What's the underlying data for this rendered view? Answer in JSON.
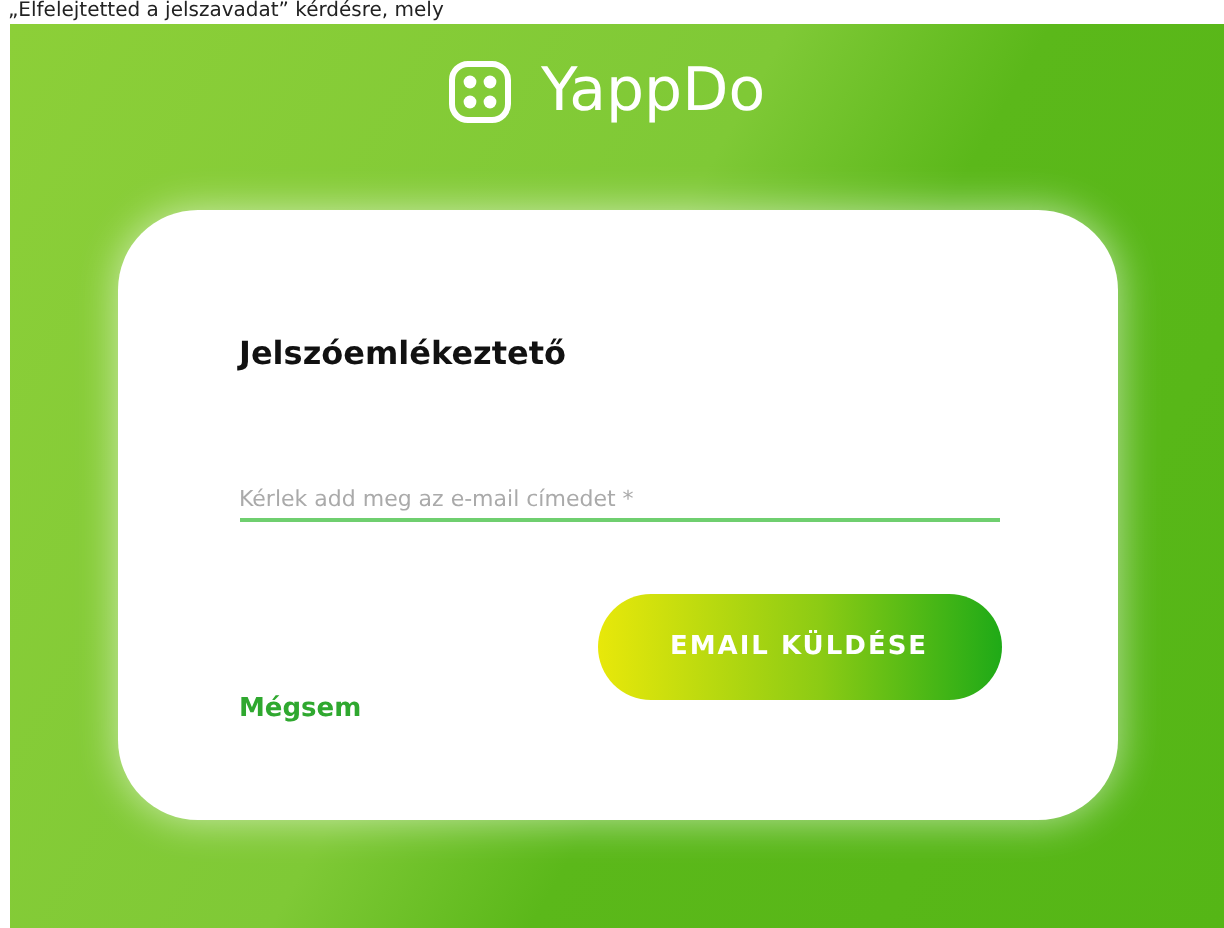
{
  "caption": "„Elfelejtetted a jelszavadat” kérdésre, mely",
  "logo": {
    "name": "YappDo"
  },
  "card": {
    "title": "Jelszóemlékeztető",
    "email": {
      "placeholder": "Kérlek add meg az e-mail címedet *"
    },
    "cancel": "Mégsem",
    "submit": "EMAIL KÜLDÉSE"
  }
}
